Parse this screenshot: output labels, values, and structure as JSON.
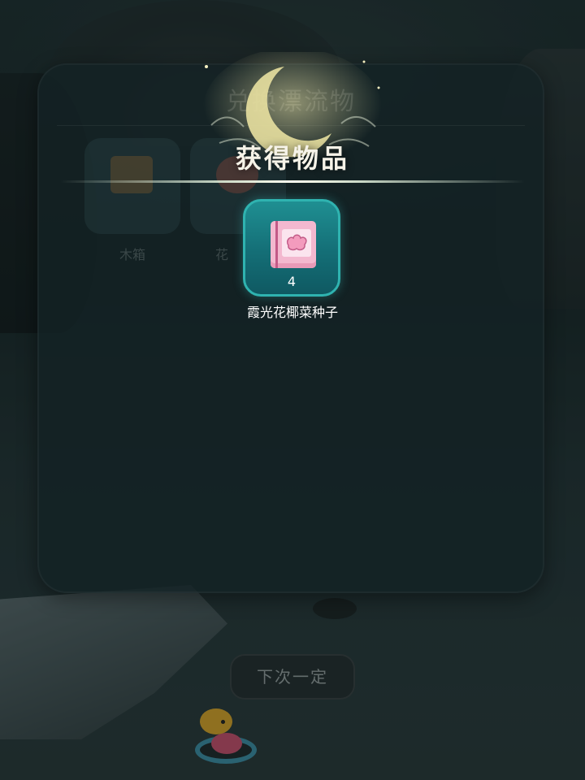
{
  "background_panel": {
    "title": "兑换漂流物",
    "items": [
      {
        "label": "木箱"
      },
      {
        "label": "花"
      }
    ]
  },
  "dialog": {
    "title": "获得物品",
    "reward": {
      "icon": "seed-pack-icon",
      "quantity": "4",
      "name": "霞光花椰菜种子"
    }
  },
  "footer": {
    "button_label": "下次一定"
  },
  "colors": {
    "card_border": "#2fb3b0",
    "card_fill": "#146e76",
    "title_text": "#f6f3e8"
  }
}
